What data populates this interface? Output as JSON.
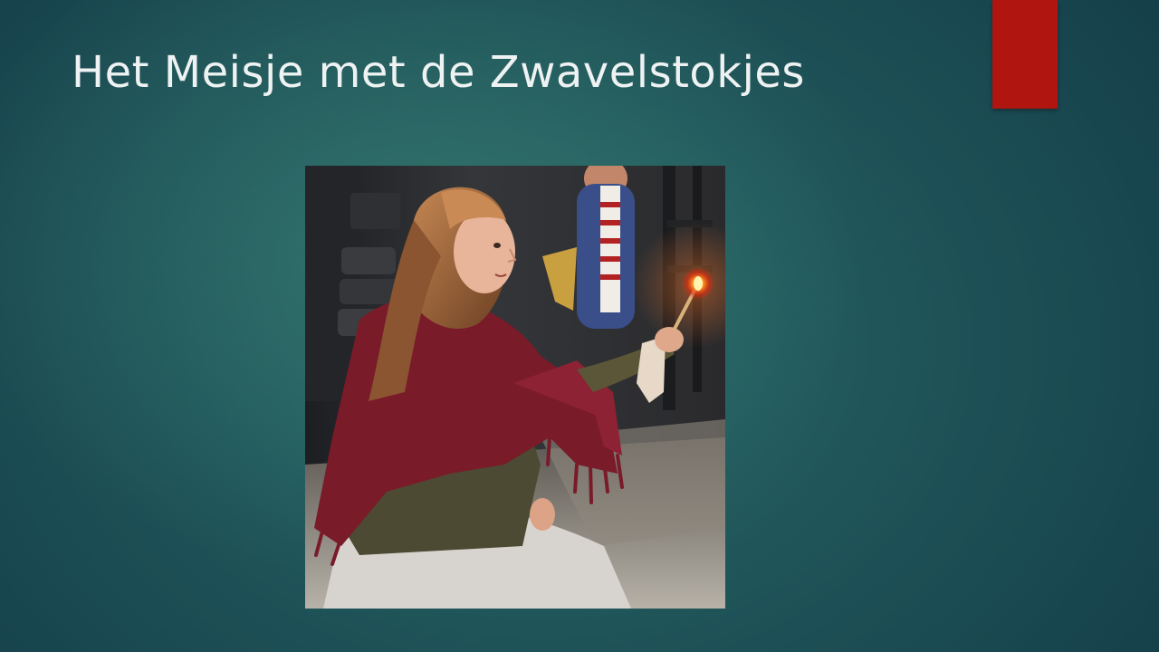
{
  "slide": {
    "title": "Het Meisje met de Zwavelstokjes",
    "accent_color": "#b0160f",
    "title_color": "#eef2f2",
    "background_color": "#1f5459"
  },
  "photo": {
    "subject": "girl in red shawl holding a lit match",
    "icon": "photo-image"
  }
}
